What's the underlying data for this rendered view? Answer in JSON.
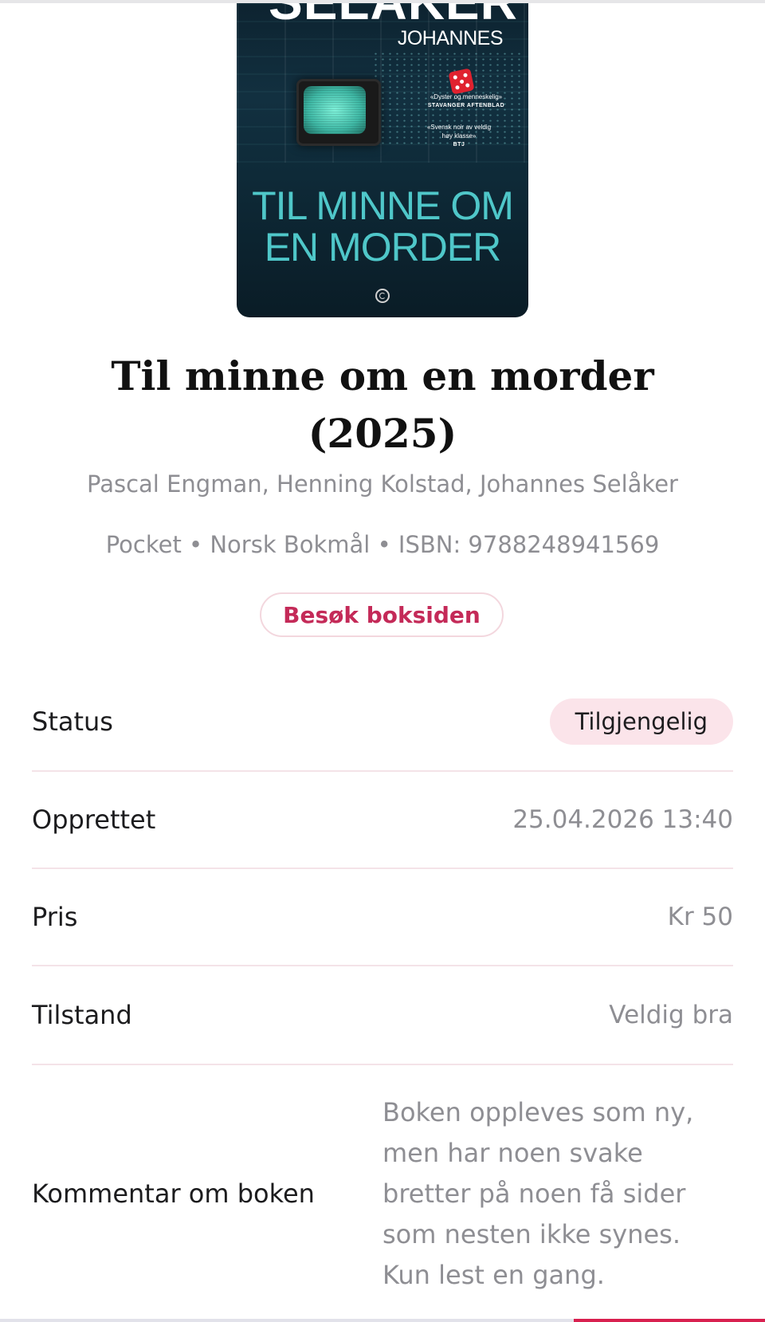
{
  "cover": {
    "author_last": "SELÅKER",
    "author_first": "JOHANNES",
    "quote1_text": "«Dyster og menneskelig»",
    "quote1_source": "STAVANGER AFTENBLAD",
    "quote2_text": "«Svensk noir av veldig høy klasse»",
    "quote2_source": "BTJ",
    "title_line1": "TIL MINNE OM",
    "title_line2": "EN MORDER",
    "colors": {
      "title": "#4fc7c9",
      "background": "#0e2a38",
      "dice": "#e0222f"
    }
  },
  "book": {
    "title": "Til minne om en morder (2025)",
    "authors": "Pascal Engman, Henning Kolstad, Johannes Selåker",
    "meta": "Pocket • Norsk Bokmål • ISBN: 9788248941569",
    "visit_button": "Besøk boksiden"
  },
  "details": {
    "status_label": "Status",
    "status_value": "Tilgjengelig",
    "created_label": "Opprettet",
    "created_value": "25.04.2026 13:40",
    "price_label": "Pris",
    "price_value": "Kr 50",
    "condition_label": "Tilstand",
    "condition_value": "Veldig bra",
    "comment_label": "Kommentar om boken",
    "comment_value": "Boken oppleves som ny, men har noen svake bretter på noen få sider som nesten ikke synes. Kun lest en gang."
  },
  "colors": {
    "accent": "#c42a58",
    "badge_bg": "#fbe4ea",
    "divider": "#f4e3e8",
    "muted_text": "#8e8e93"
  }
}
